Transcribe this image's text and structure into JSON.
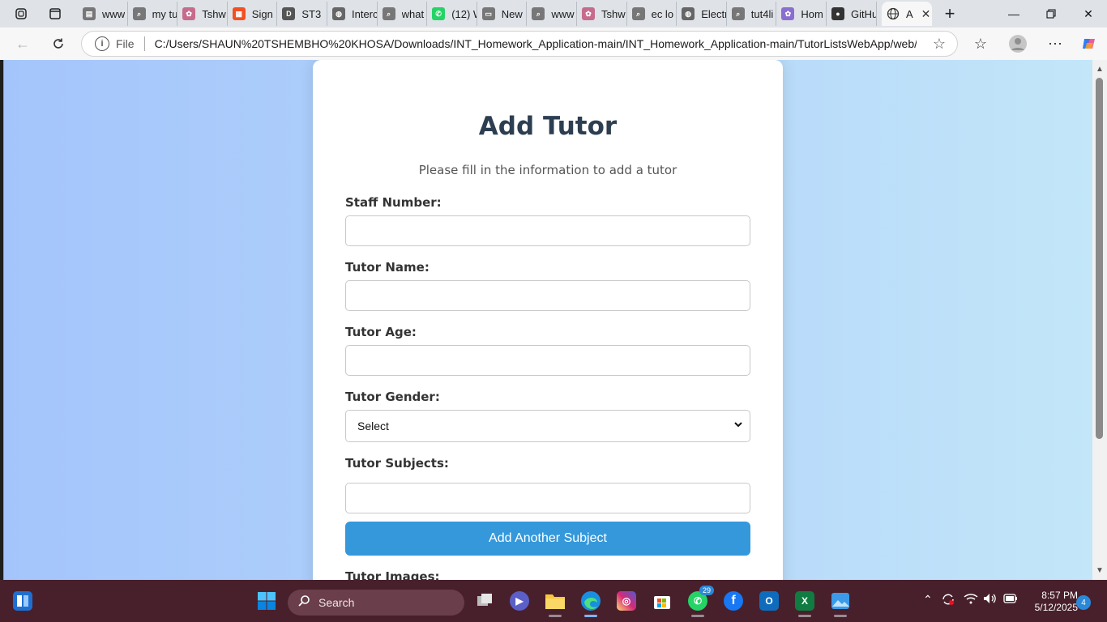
{
  "browser": {
    "tabs": [
      {
        "label": "www",
        "fav": "doc-icon",
        "color": "#777777"
      },
      {
        "label": "my tu",
        "fav": "search-icon",
        "color": "#777777"
      },
      {
        "label": "Tshw",
        "fav": "copilot-icon",
        "color": "#c76b8c"
      },
      {
        "label": "Sign",
        "fav": "microsoft-icon",
        "color": "#f25022"
      },
      {
        "label": "ST3",
        "fav": "d2l-icon",
        "color": "#555555"
      },
      {
        "label": "Interc",
        "fav": "globe-icon",
        "color": "#666666"
      },
      {
        "label": "what",
        "fav": "search-icon",
        "color": "#777777"
      },
      {
        "label": "(12) W",
        "fav": "whatsapp-icon",
        "color": "#25d366"
      },
      {
        "label": "New",
        "fav": "newtab-icon",
        "color": "#777777"
      },
      {
        "label": "www",
        "fav": "search-icon",
        "color": "#777777"
      },
      {
        "label": "Tshw",
        "fav": "copilot-icon",
        "color": "#c76b8c"
      },
      {
        "label": "ec lo",
        "fav": "search-icon",
        "color": "#777777"
      },
      {
        "label": "Electr",
        "fav": "globe-icon",
        "color": "#666666"
      },
      {
        "label": "tut4li",
        "fav": "search-icon",
        "color": "#777777"
      },
      {
        "label": "Hom",
        "fav": "copilot-icon",
        "color": "#8a6fd1"
      },
      {
        "label": "GitHu",
        "fav": "github-icon",
        "color": "#333333"
      }
    ],
    "active_tab": {
      "label": "A",
      "fav": "globe-icon"
    },
    "address": {
      "scheme_label": "File",
      "url": "C:/Users/SHAUN%20TSHEMBHO%20KHOSA/Downloads/INT_Homework_Application-main/INT_Homework_Application-main/TutorListsWebApp/web/..."
    }
  },
  "page": {
    "title": "Add Tutor",
    "subtitle": "Please fill in the information to add a tutor",
    "fields": {
      "staff_number": {
        "label": "Staff Number:",
        "value": ""
      },
      "tutor_name": {
        "label": "Tutor Name:",
        "value": ""
      },
      "tutor_age": {
        "label": "Tutor Age:",
        "value": ""
      },
      "tutor_gender": {
        "label": "Tutor Gender:",
        "selected": "Select"
      },
      "tutor_subjects": {
        "label": "Tutor Subjects:",
        "value": ""
      },
      "tutor_images": {
        "label": "Tutor Images:"
      }
    },
    "add_subject_button": "Add Another Subject",
    "colors": {
      "primary_button": "#3498db",
      "heading": "#2c3e50",
      "background_left": "#a4c5fb",
      "background_right": "#c3e6f9"
    }
  },
  "taskbar": {
    "search_placeholder": "Search",
    "whatsapp_badge": "29",
    "clock_time": "8:57 PM",
    "clock_date": "5/12/2025",
    "notification_count": "4"
  }
}
